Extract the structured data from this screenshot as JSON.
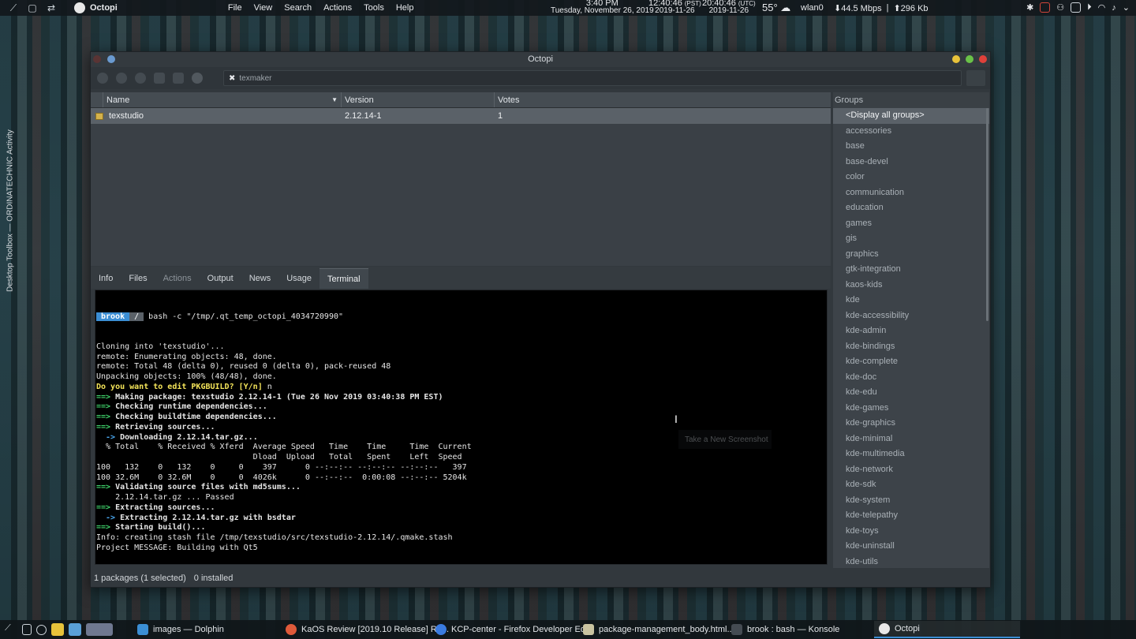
{
  "top_panel": {
    "app_name": "Octopi",
    "menu": [
      "File",
      "View",
      "Search",
      "Actions",
      "Tools",
      "Help"
    ],
    "clock_local_time": "3:40 PM",
    "clock_local_date": "Tuesday, November 26, 2019",
    "clock_pst_time": "12:40:46",
    "clock_pst_label": "(PST)",
    "clock_pst_date": "2019-11-26",
    "clock_utc_time": "20:40:46",
    "clock_utc_label": "(UTC)",
    "clock_utc_date": "2019-11-26",
    "weather": "55°",
    "network_iface": "wlan0",
    "net_down": "⬇44.5 Mbps",
    "net_up": "⬆296 Kb"
  },
  "side_tab": "Desktop Toolbox — ORDINATECHNIC Activity",
  "window": {
    "title": "Octopi",
    "search_value": "texmaker",
    "columns": {
      "name": "Name",
      "version": "Version",
      "votes": "Votes"
    },
    "packages": [
      {
        "name": "texstudio",
        "version": "2.12.14-1",
        "votes": "1"
      }
    ],
    "groups_header": "Groups",
    "groups": [
      "<Display all groups>",
      "accessories",
      "base",
      "base-devel",
      "color",
      "communication",
      "education",
      "games",
      "gis",
      "graphics",
      "gtk-integration",
      "kaos-kids",
      "kde",
      "kde-accessibility",
      "kde-admin",
      "kde-bindings",
      "kde-complete",
      "kde-doc",
      "kde-edu",
      "kde-games",
      "kde-graphics",
      "kde-minimal",
      "kde-multimedia",
      "kde-network",
      "kde-sdk",
      "kde-system",
      "kde-telepathy",
      "kde-toys",
      "kde-uninstall",
      "kde-utils"
    ],
    "tabs": [
      "Info",
      "Files",
      "Actions",
      "Output",
      "News",
      "Usage",
      "Terminal"
    ],
    "status_packages": "1 packages (1 selected)",
    "status_installed": "0 installed"
  },
  "terminal": {
    "prompt_user": "brook",
    "prompt_dir": "/",
    "command": "bash -c \"/tmp/.qt_temp_octopi_4034720990\"",
    "lines": [
      {
        "style": "",
        "text": "Cloning into 'texstudio'..."
      },
      {
        "style": "",
        "text": "remote: Enumerating objects: 48, done."
      },
      {
        "style": "",
        "text": "remote: Total 48 (delta 0), reused 0 (delta 0), pack-reused 48"
      },
      {
        "style": "",
        "text": "Unpacking objects: 100% (48/48), done."
      },
      {
        "style": "yellow",
        "text": "Do you want to edit PKGBUILD? [Y/n] ",
        "suffix": "n"
      },
      {
        "style": "green",
        "arrow": "==>",
        "text": " Making package: texstudio 2.12.14-1 (Tue 26 Nov 2019 03:40:38 PM EST)"
      },
      {
        "style": "green",
        "arrow": "==>",
        "text": " Checking runtime dependencies..."
      },
      {
        "style": "green",
        "arrow": "==>",
        "text": " Checking buildtime dependencies..."
      },
      {
        "style": "green",
        "arrow": "==>",
        "text": " Retrieving sources..."
      },
      {
        "style": "blue",
        "arrow": "  ->",
        "text": " Downloading 2.12.14.tar.gz..."
      },
      {
        "style": "",
        "text": "  % Total    % Received % Xferd  Average Speed   Time    Time     Time  Current"
      },
      {
        "style": "",
        "text": "                                 Dload  Upload   Total   Spent    Left  Speed"
      },
      {
        "style": "",
        "text": "100   132    0   132    0     0    397      0 --:--:-- --:--:-- --:--:--   397"
      },
      {
        "style": "",
        "text": "100 32.6M    0 32.6M    0     0  4026k      0 --:--:--  0:00:08 --:--:-- 5204k"
      },
      {
        "style": "green",
        "arrow": "==>",
        "text": " Validating source files with md5sums..."
      },
      {
        "style": "",
        "text": "    2.12.14.tar.gz ... Passed"
      },
      {
        "style": "green",
        "arrow": "==>",
        "text": " Extracting sources..."
      },
      {
        "style": "blue",
        "arrow": "  ->",
        "text": " Extracting 2.12.14.tar.gz with bsdtar"
      },
      {
        "style": "green",
        "arrow": "==>",
        "text": " Starting build()..."
      },
      {
        "style": "",
        "text": "Info: creating stash file /tmp/texstudio/src/texstudio-2.12.14/.qmake.stash"
      },
      {
        "style": "",
        "text": "Project MESSAGE: Building with Qt5"
      }
    ]
  },
  "tooltip": "Take a New Screenshot",
  "taskbar": {
    "tasks": [
      {
        "label": "images — Dolphin",
        "color": "#3b8ed4"
      },
      {
        "label": "KaOS Review [2019.10 Release] Re...",
        "color": "#e05a3a"
      },
      {
        "label": "KCP-center - Firefox Developer Ed...",
        "color": "#3a7be0"
      },
      {
        "label": "package-management_body.html...",
        "color": "#c9c3a0"
      },
      {
        "label": "brook : bash — Konsole",
        "color": "#444b52"
      },
      {
        "label": "Octopi",
        "color": "#e8e8e8"
      }
    ]
  },
  "colors": {
    "accent": "#3b8ed4",
    "terminal_green": "#3fd26a",
    "terminal_yellow": "#f5e55a",
    "terminal_blue": "#4aa8f0",
    "close_button": "#e0413a",
    "minimize_button": "#e8c23a",
    "maximize_button": "#6ac248"
  }
}
